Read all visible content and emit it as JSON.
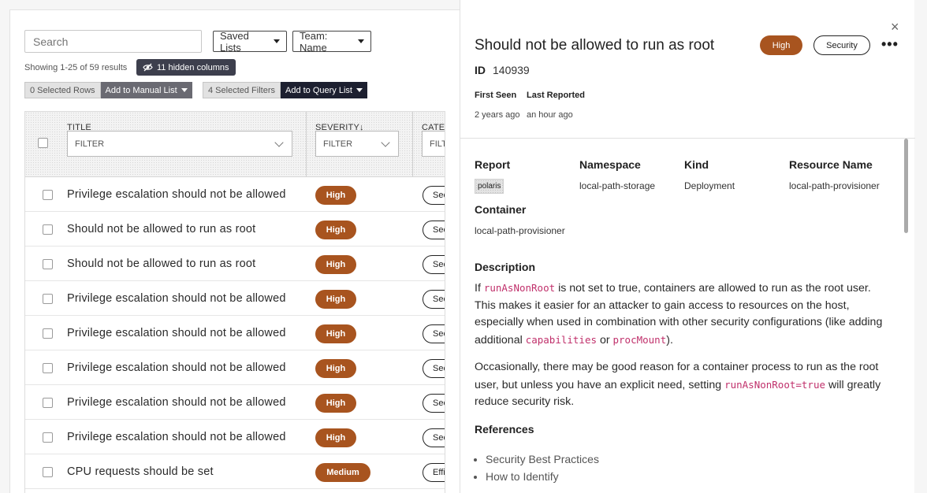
{
  "left": {
    "search_placeholder": "Search",
    "saved_lists_label": "Saved Lists",
    "team_label": "Team: Name",
    "showing_text": "Showing 1-25 of 59 results",
    "hidden_columns": "11 hidden columns",
    "selected_rows": "0 Selected Rows",
    "add_manual": "Add to Manual List",
    "selected_filters": "4 Selected Filters",
    "add_query": "Add to Query List",
    "columns": {
      "title": "TITLE",
      "severity": "SEVERITY↓",
      "category": "CATEGORY",
      "filter_placeholder": "FILTER"
    },
    "rows": [
      {
        "title": "Privilege escalation should not be allowed",
        "severity": "High",
        "category": "Security"
      },
      {
        "title": "Should not be allowed to run as root",
        "severity": "High",
        "category": "Security"
      },
      {
        "title": "Should not be allowed to run as root",
        "severity": "High",
        "category": "Security"
      },
      {
        "title": "Privilege escalation should not be allowed",
        "severity": "High",
        "category": "Security"
      },
      {
        "title": "Privilege escalation should not be allowed",
        "severity": "High",
        "category": "Security"
      },
      {
        "title": "Privilege escalation should not be allowed",
        "severity": "High",
        "category": "Security"
      },
      {
        "title": "Privilege escalation should not be allowed",
        "severity": "High",
        "category": "Security"
      },
      {
        "title": "Privilege escalation should not be allowed",
        "severity": "High",
        "category": "Security"
      },
      {
        "title": "CPU requests should be set",
        "severity": "Medium",
        "category": "Efficiency"
      }
    ]
  },
  "detail": {
    "title": "Should not be allowed to run as root",
    "severity": "High",
    "category": "Security",
    "more": "•••",
    "close": "×",
    "id_label": "ID",
    "id_value": "140939",
    "first_seen_label": "First Seen",
    "first_seen_value": "2 years ago",
    "last_reported_label": "Last Reported",
    "last_reported_value": "an hour ago",
    "report_label": "Report",
    "report_value": "polaris",
    "namespace_label": "Namespace",
    "namespace_value": "local-path-storage",
    "kind_label": "Kind",
    "kind_value": "Deployment",
    "resource_label": "Resource Name",
    "resource_value": "local-path-provisioner",
    "container_label": "Container",
    "container_value": "local-path-provisioner",
    "description_label": "Description",
    "desc_p1": {
      "a": "If ",
      "code1": "runAsNonRoot",
      "b": " is not set to true, containers are allowed to run as the root user. This makes it easier for an attacker to gain access to resources on the host, especially when used in combination with other security configurations (like adding additional ",
      "code2": "capabilities",
      "c": " or ",
      "code3": "procMount",
      "d": ")."
    },
    "desc_p2": {
      "a": "Occasionally, there may be good reason for a container process to run as the root user, but unless you have an explicit need, setting ",
      "code1": "runAsNonRoot=true",
      "b": " will greatly reduce security risk."
    },
    "references_label": "References",
    "references": [
      "Security Best Practices",
      "How to Identify"
    ]
  }
}
